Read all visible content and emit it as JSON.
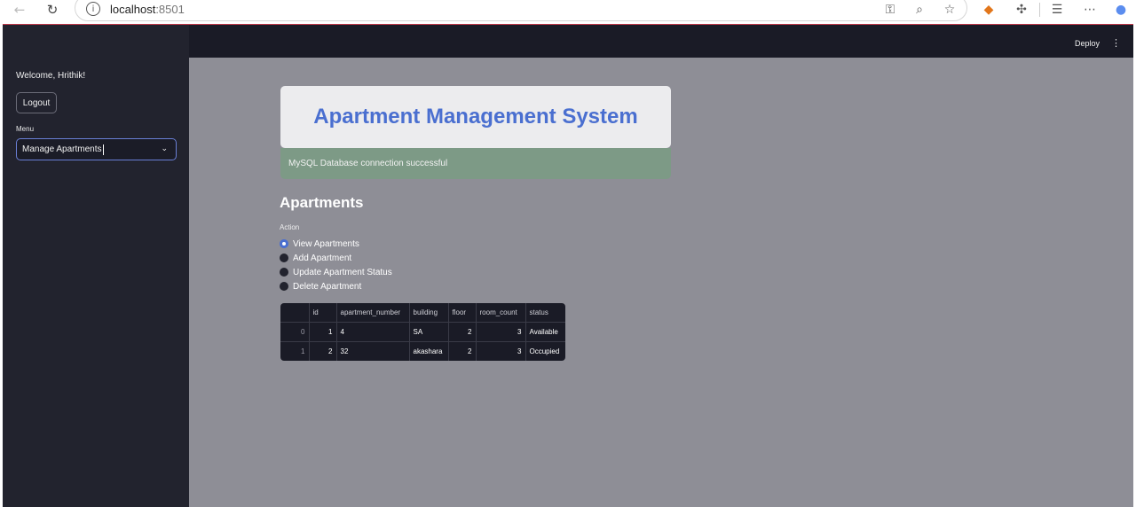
{
  "browser": {
    "url_host": "localhost",
    "url_port": ":8501"
  },
  "sidebar": {
    "welcome": "Welcome, Hrithik!",
    "logout_label": "Logout",
    "menu_label": "Menu",
    "menu_selected": "Manage Apartments"
  },
  "topbar": {
    "deploy_label": "Deploy"
  },
  "main": {
    "title": "Apartment Management System",
    "db_status": "MySQL Database connection successful",
    "section_title": "Apartments",
    "action_label": "Action",
    "actions": [
      {
        "label": "View Apartments",
        "selected": true
      },
      {
        "label": "Add Apartment",
        "selected": false
      },
      {
        "label": "Update Apartment Status",
        "selected": false
      },
      {
        "label": "Delete Apartment",
        "selected": false
      }
    ],
    "table": {
      "columns": [
        "",
        "id",
        "apartment_number",
        "building",
        "floor",
        "room_count",
        "status"
      ],
      "rows": [
        [
          "0",
          "1",
          "4",
          "SA",
          "2",
          "3",
          "Available"
        ],
        [
          "1",
          "2",
          "32",
          "akashara",
          "2",
          "3",
          "Occupied"
        ]
      ]
    }
  },
  "colors": {
    "accent": "#4a6fd0",
    "sidebar_bg": "#22232e",
    "main_bg": "#8e8e96",
    "success_bg": "#7d9a86"
  }
}
